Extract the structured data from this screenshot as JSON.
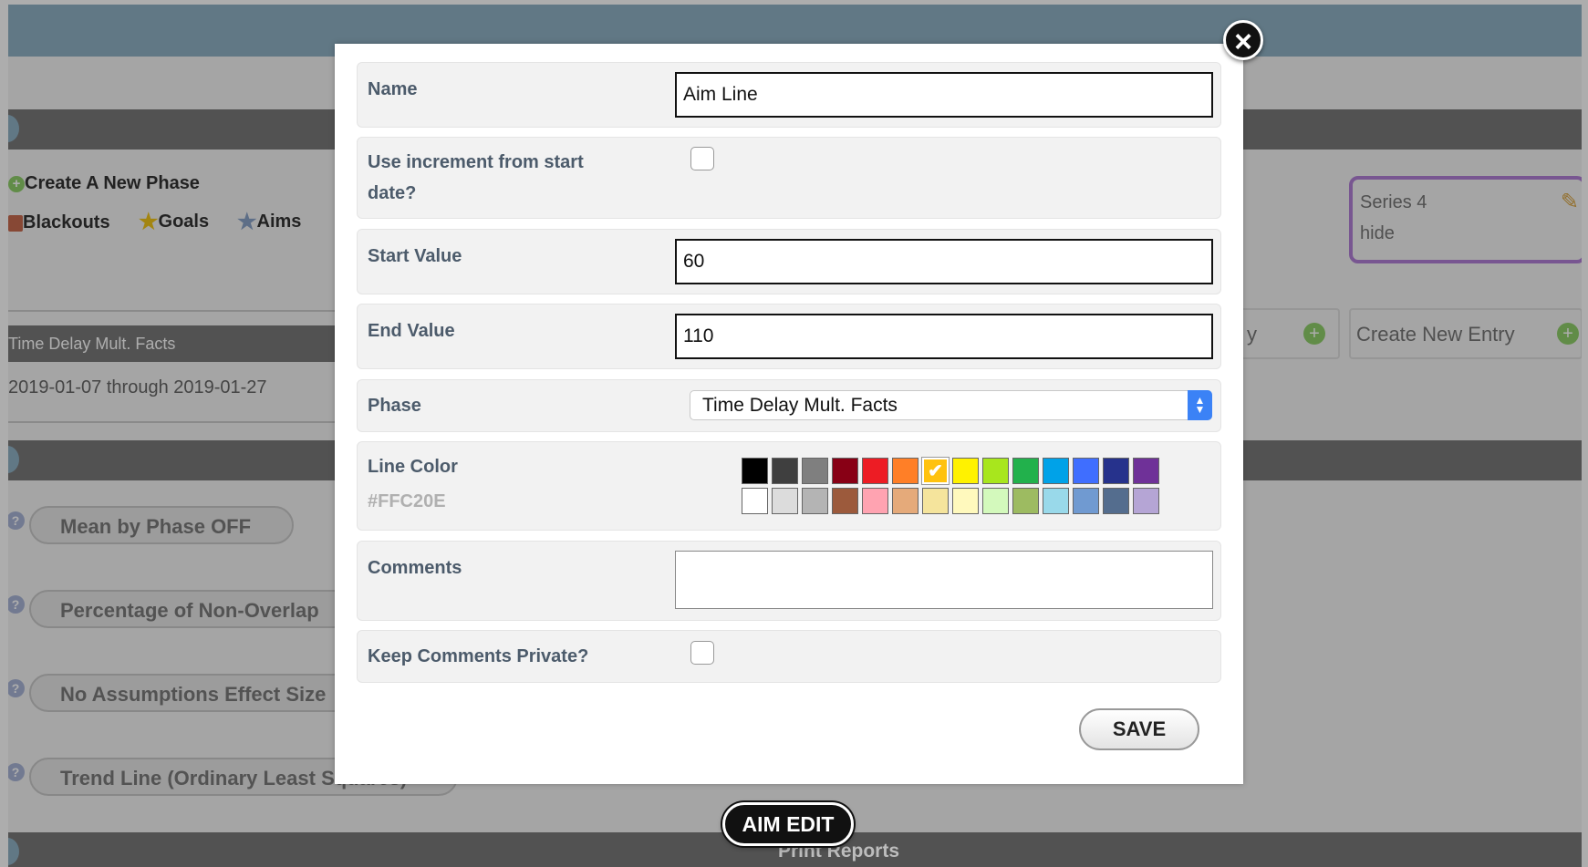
{
  "background": {
    "phase_actions": {
      "create_phase": "Create A New Phase",
      "blackouts": "Blackouts",
      "goals": "Goals",
      "aims": "Aims"
    },
    "phase_card": {
      "title": "Time Delay Mult. Facts",
      "date_range": "2019-01-07 through 2019-01-27"
    },
    "series_card": {
      "name": "Series 4",
      "hide_label": "hide"
    },
    "entries": {
      "partial_label": "y",
      "create_entry": "Create New Entry"
    },
    "analysis_buttons": [
      "Mean by Phase OFF",
      "Percentage of Non-Overlap",
      "No Assumptions Effect Size",
      "Trend Line (Ordinary Least Squares)"
    ],
    "print_reports": "Print Reports"
  },
  "modal": {
    "close_label": "×",
    "fields": {
      "name": {
        "label": "Name",
        "value": "Aim Line"
      },
      "increment": {
        "label_line1": "Use increment from start",
        "label_line2": "date?",
        "checked": false
      },
      "start_value": {
        "label": "Start Value",
        "value": "60"
      },
      "end_value": {
        "label": "End Value",
        "value": "110"
      },
      "phase": {
        "label": "Phase",
        "selected": "Time Delay Mult. Facts"
      },
      "line_color": {
        "label": "Line Color",
        "value": "#FFC20E"
      },
      "comments": {
        "label": "Comments",
        "value": ""
      },
      "keep_private": {
        "label": "Keep Comments Private?",
        "checked": false
      }
    },
    "palette": {
      "selected": "#FFC20E",
      "row1": [
        "#000000",
        "#3f3f3f",
        "#7f7f7f",
        "#880015",
        "#ed1c24",
        "#ff7f27",
        "#ffc20e",
        "#fff200",
        "#a8e61d",
        "#22b14c",
        "#00a2e8",
        "#3f6eff",
        "#26328c",
        "#6f3198"
      ],
      "row2": [
        "#ffffff",
        "#dcdcdc",
        "#b4b4b4",
        "#9c5a3c",
        "#ffa3b1",
        "#e5aa7a",
        "#f5e49c",
        "#fff9bd",
        "#d3f9bc",
        "#9dbb61",
        "#99d9ea",
        "#709ad1",
        "#546d8e",
        "#b5a5d5"
      ]
    },
    "save_label": "SAVE"
  },
  "aim_edit_label": "AIM EDIT"
}
